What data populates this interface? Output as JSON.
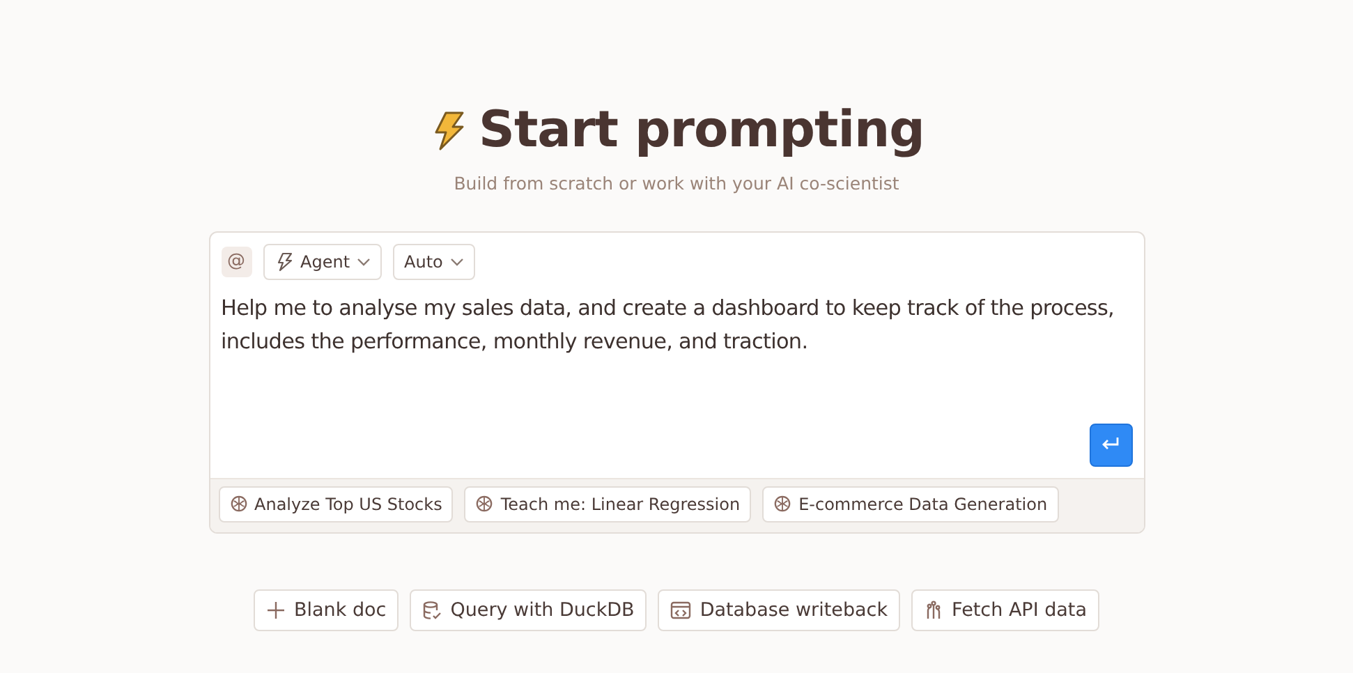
{
  "title": "Start prompting",
  "subtitle": "Build from scratch or work with your AI co-scientist",
  "composer": {
    "mention": "@",
    "selectors": [
      {
        "kind": "mode",
        "label": "Agent"
      },
      {
        "kind": "model",
        "label": "Auto"
      }
    ],
    "prompt": "Help me to analyse my sales data, and create a dashboard to keep track of the process, includes the performance, monthly revenue, and traction.",
    "suggestions": [
      "Analyze Top US Stocks",
      "Teach me: Linear Regression",
      "E-commerce Data Generation"
    ]
  },
  "quick_actions": [
    {
      "kind": "blank",
      "label": "Blank doc"
    },
    {
      "kind": "query",
      "label": "Query with DuckDB"
    },
    {
      "kind": "writeback",
      "label": "Database writeback"
    },
    {
      "kind": "fetch",
      "label": "Fetch API data"
    }
  ]
}
